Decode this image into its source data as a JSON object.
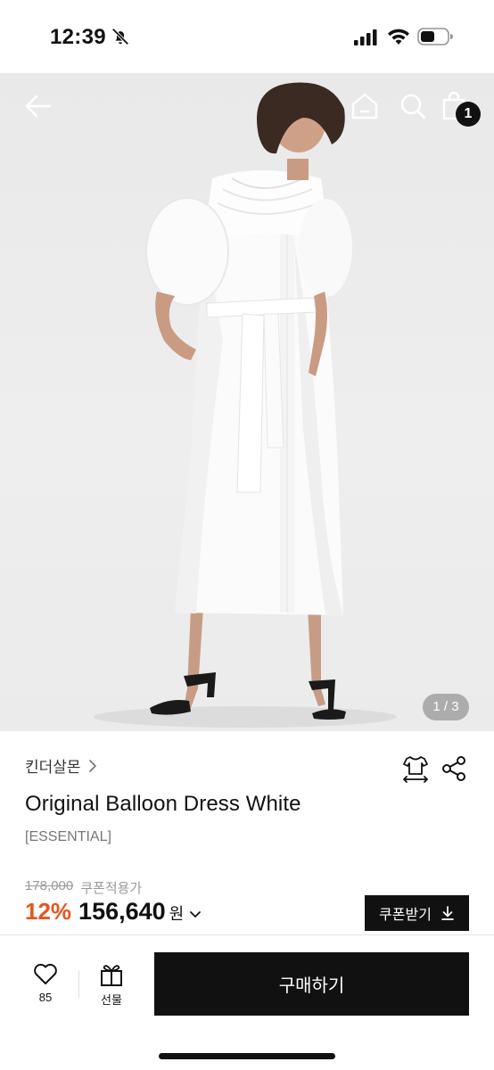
{
  "status_bar": {
    "time": "12:39",
    "icons": [
      "bell-slash-icon",
      "signal-icon",
      "wifi-icon",
      "battery-icon"
    ]
  },
  "header": {
    "icons": [
      "back-arrow-icon",
      "home-icon",
      "search-icon",
      "shopping-bag-icon"
    ],
    "cart_count": "1"
  },
  "gallery": {
    "page_indicator": "1 / 3"
  },
  "product": {
    "brand": "킨더살몬",
    "title": "Original Balloon Dress White",
    "subtitle": "[ESSENTIAL]",
    "original_price": "178,000",
    "coupon_note": "쿠폰적용가",
    "discount": "12%",
    "sale_price": "156,640",
    "currency": "원",
    "coupon_button": "쿠폰받기"
  },
  "bottom_bar": {
    "like_count": "85",
    "gift_label": "선물",
    "buy_label": "구매하기"
  },
  "colors": {
    "accent_discount": "#e8541f",
    "primary": "#111111"
  }
}
